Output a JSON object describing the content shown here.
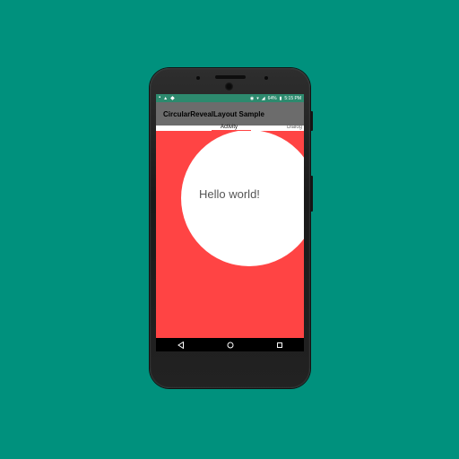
{
  "status_bar": {
    "battery": "64%",
    "time": "5:15 PM"
  },
  "toolbar": {
    "title": "CircularRevealLayout Sample"
  },
  "tabs": [
    {
      "label": "Activity",
      "selected": true
    },
    {
      "label": "Dialog",
      "selected": false
    }
  ],
  "content": {
    "message": "Hello world!"
  },
  "colors": {
    "background": "#00917d",
    "status_bar": "#2d8a6e",
    "toolbar": "#6c6c6c",
    "reveal_background": "#ff4444",
    "circle": "#ffffff"
  },
  "nav_bar": {
    "icons": [
      "back-icon",
      "home-icon",
      "recents-icon"
    ]
  }
}
